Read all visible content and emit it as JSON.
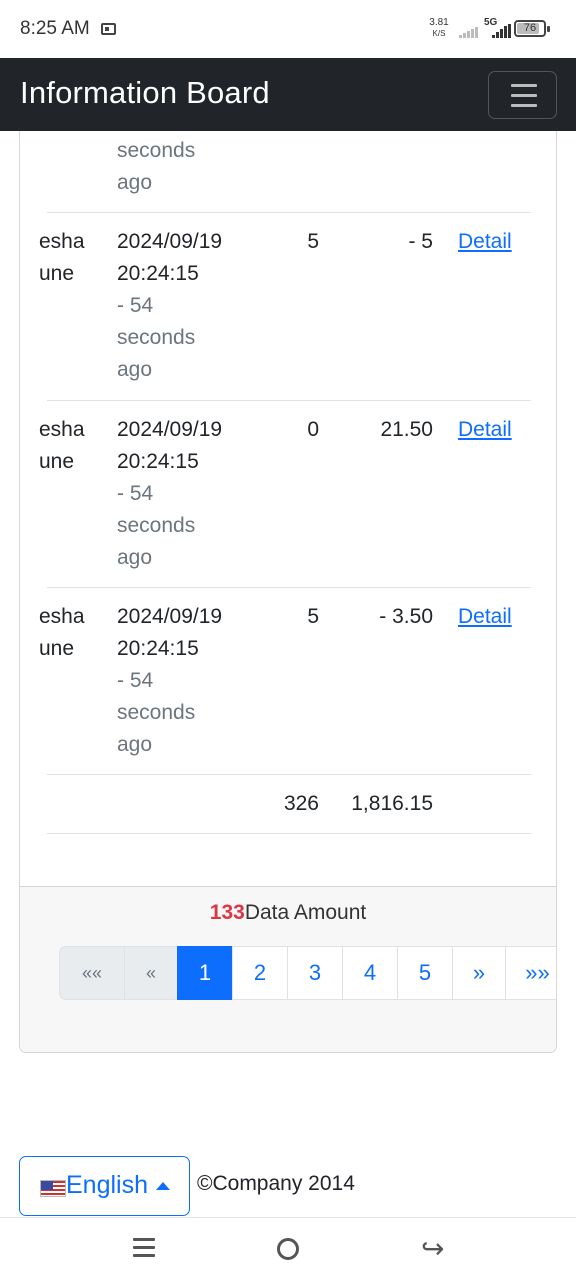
{
  "status_bar": {
    "time": "8:25 AM",
    "speed": "3.81",
    "speed_unit": "K/S",
    "network": "5G",
    "battery": "76"
  },
  "navbar": {
    "brand": "Information Board",
    "toggle_icon": "hamburger-menu-icon"
  },
  "table": {
    "partial_row": {
      "date_line3": "seconds",
      "date_line4": "ago"
    },
    "rows": [
      {
        "name_line1": "esha",
        "name_line2": "une",
        "date": "2024/09/19",
        "time": "20:24:15",
        "rel1": "- 54",
        "rel2": "seconds",
        "rel3": "ago",
        "qty": "5",
        "amount": "- 5",
        "link": "Detail"
      },
      {
        "name_line1": "esha",
        "name_line2": "une",
        "date": "2024/09/19",
        "time": "20:24:15",
        "rel1": "- 54",
        "rel2": "seconds",
        "rel3": "ago",
        "qty": "0",
        "amount": "21.50",
        "link": "Detail"
      },
      {
        "name_line1": "esha",
        "name_line2": "une",
        "date": "2024/09/19",
        "time": "20:24:15",
        "rel1": "- 54",
        "rel2": "seconds",
        "rel3": "ago",
        "qty": "5",
        "amount": "- 3.50",
        "link": "Detail"
      }
    ],
    "totals": {
      "qty": "326",
      "amount": "1,816.15"
    }
  },
  "summary": {
    "count": "133",
    "label": "Data Amount"
  },
  "pagination": {
    "first": "««",
    "prev": "«",
    "pages": [
      "1",
      "2",
      "3",
      "4",
      "5"
    ],
    "active_page": "1",
    "next": "»",
    "last": "»»"
  },
  "footer": {
    "language": "English",
    "copyright": "©Company 2014"
  },
  "system_nav": {
    "menu_icon": "recent-apps-icon",
    "home_icon": "home-icon",
    "back_icon": "back-icon"
  }
}
